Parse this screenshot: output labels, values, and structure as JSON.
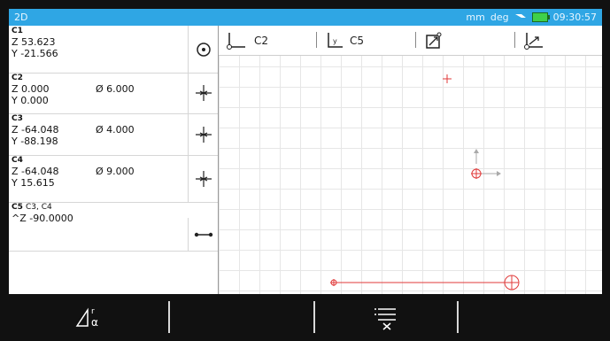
{
  "status": {
    "title": "2D",
    "units": "mm",
    "angle_units": "deg",
    "time": "09:30:57",
    "battery_color": "#3fd04a",
    "accent": "#2fa6e4"
  },
  "features": [
    {
      "name": "C1",
      "sub": "",
      "line1": "Z 53.623",
      "line2": "Y -21.566",
      "diameter": "",
      "icon": "circle-center-icon"
    },
    {
      "name": "C2",
      "sub": "",
      "line1": "Z 0.000",
      "line2": "Y 0.000",
      "diameter": "Ø 6.000",
      "icon": "point-crosshair-icon"
    },
    {
      "name": "C3",
      "sub": "",
      "line1": "Z -64.048",
      "line2": "Y -88.198",
      "diameter": "Ø 4.000",
      "icon": "point-crosshair-icon"
    },
    {
      "name": "C4",
      "sub": "",
      "line1": "Z -64.048",
      "line2": "Y 15.615",
      "diameter": "Ø 9.000",
      "icon": "point-crosshair-icon"
    },
    {
      "name": "C5",
      "sub": "C3, C4",
      "line1": "^Z -90.0000",
      "line2": "",
      "diameter": "",
      "icon": "line-segment-icon"
    }
  ],
  "toolbar": {
    "origin_label": "C2",
    "axis_label": "C5",
    "axis_sub": "y"
  },
  "graph": {
    "marker_color": "#e03a3a"
  },
  "bottom": {
    "buttons": [
      "angle-radius-icon",
      "list-delete-icon"
    ]
  }
}
